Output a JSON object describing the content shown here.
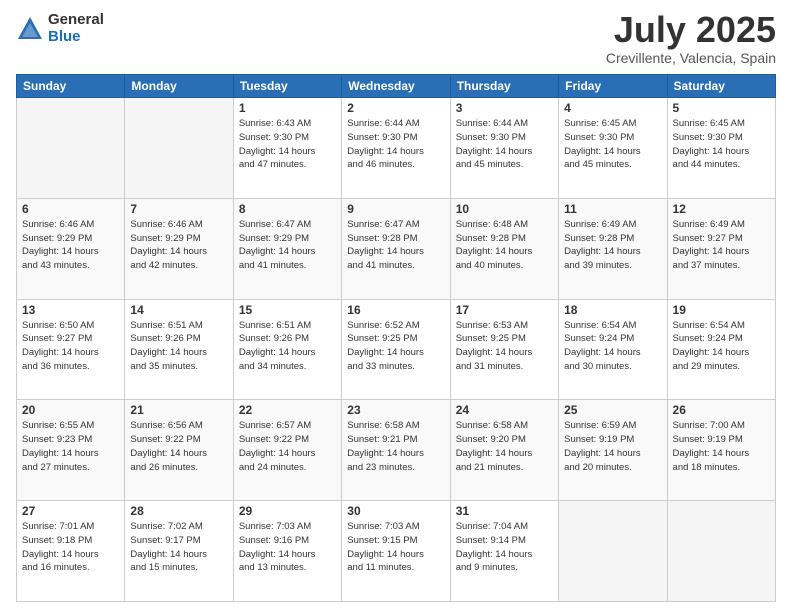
{
  "logo": {
    "general": "General",
    "blue": "Blue"
  },
  "title": {
    "month": "July 2025",
    "location": "Crevillente, Valencia, Spain"
  },
  "weekdays": [
    "Sunday",
    "Monday",
    "Tuesday",
    "Wednesday",
    "Thursday",
    "Friday",
    "Saturday"
  ],
  "weeks": [
    [
      {
        "day": "",
        "info": ""
      },
      {
        "day": "",
        "info": ""
      },
      {
        "day": "1",
        "info": "Sunrise: 6:43 AM\nSunset: 9:30 PM\nDaylight: 14 hours\nand 47 minutes."
      },
      {
        "day": "2",
        "info": "Sunrise: 6:44 AM\nSunset: 9:30 PM\nDaylight: 14 hours\nand 46 minutes."
      },
      {
        "day": "3",
        "info": "Sunrise: 6:44 AM\nSunset: 9:30 PM\nDaylight: 14 hours\nand 45 minutes."
      },
      {
        "day": "4",
        "info": "Sunrise: 6:45 AM\nSunset: 9:30 PM\nDaylight: 14 hours\nand 45 minutes."
      },
      {
        "day": "5",
        "info": "Sunrise: 6:45 AM\nSunset: 9:30 PM\nDaylight: 14 hours\nand 44 minutes."
      }
    ],
    [
      {
        "day": "6",
        "info": "Sunrise: 6:46 AM\nSunset: 9:29 PM\nDaylight: 14 hours\nand 43 minutes."
      },
      {
        "day": "7",
        "info": "Sunrise: 6:46 AM\nSunset: 9:29 PM\nDaylight: 14 hours\nand 42 minutes."
      },
      {
        "day": "8",
        "info": "Sunrise: 6:47 AM\nSunset: 9:29 PM\nDaylight: 14 hours\nand 41 minutes."
      },
      {
        "day": "9",
        "info": "Sunrise: 6:47 AM\nSunset: 9:28 PM\nDaylight: 14 hours\nand 41 minutes."
      },
      {
        "day": "10",
        "info": "Sunrise: 6:48 AM\nSunset: 9:28 PM\nDaylight: 14 hours\nand 40 minutes."
      },
      {
        "day": "11",
        "info": "Sunrise: 6:49 AM\nSunset: 9:28 PM\nDaylight: 14 hours\nand 39 minutes."
      },
      {
        "day": "12",
        "info": "Sunrise: 6:49 AM\nSunset: 9:27 PM\nDaylight: 14 hours\nand 37 minutes."
      }
    ],
    [
      {
        "day": "13",
        "info": "Sunrise: 6:50 AM\nSunset: 9:27 PM\nDaylight: 14 hours\nand 36 minutes."
      },
      {
        "day": "14",
        "info": "Sunrise: 6:51 AM\nSunset: 9:26 PM\nDaylight: 14 hours\nand 35 minutes."
      },
      {
        "day": "15",
        "info": "Sunrise: 6:51 AM\nSunset: 9:26 PM\nDaylight: 14 hours\nand 34 minutes."
      },
      {
        "day": "16",
        "info": "Sunrise: 6:52 AM\nSunset: 9:25 PM\nDaylight: 14 hours\nand 33 minutes."
      },
      {
        "day": "17",
        "info": "Sunrise: 6:53 AM\nSunset: 9:25 PM\nDaylight: 14 hours\nand 31 minutes."
      },
      {
        "day": "18",
        "info": "Sunrise: 6:54 AM\nSunset: 9:24 PM\nDaylight: 14 hours\nand 30 minutes."
      },
      {
        "day": "19",
        "info": "Sunrise: 6:54 AM\nSunset: 9:24 PM\nDaylight: 14 hours\nand 29 minutes."
      }
    ],
    [
      {
        "day": "20",
        "info": "Sunrise: 6:55 AM\nSunset: 9:23 PM\nDaylight: 14 hours\nand 27 minutes."
      },
      {
        "day": "21",
        "info": "Sunrise: 6:56 AM\nSunset: 9:22 PM\nDaylight: 14 hours\nand 26 minutes."
      },
      {
        "day": "22",
        "info": "Sunrise: 6:57 AM\nSunset: 9:22 PM\nDaylight: 14 hours\nand 24 minutes."
      },
      {
        "day": "23",
        "info": "Sunrise: 6:58 AM\nSunset: 9:21 PM\nDaylight: 14 hours\nand 23 minutes."
      },
      {
        "day": "24",
        "info": "Sunrise: 6:58 AM\nSunset: 9:20 PM\nDaylight: 14 hours\nand 21 minutes."
      },
      {
        "day": "25",
        "info": "Sunrise: 6:59 AM\nSunset: 9:19 PM\nDaylight: 14 hours\nand 20 minutes."
      },
      {
        "day": "26",
        "info": "Sunrise: 7:00 AM\nSunset: 9:19 PM\nDaylight: 14 hours\nand 18 minutes."
      }
    ],
    [
      {
        "day": "27",
        "info": "Sunrise: 7:01 AM\nSunset: 9:18 PM\nDaylight: 14 hours\nand 16 minutes."
      },
      {
        "day": "28",
        "info": "Sunrise: 7:02 AM\nSunset: 9:17 PM\nDaylight: 14 hours\nand 15 minutes."
      },
      {
        "day": "29",
        "info": "Sunrise: 7:03 AM\nSunset: 9:16 PM\nDaylight: 14 hours\nand 13 minutes."
      },
      {
        "day": "30",
        "info": "Sunrise: 7:03 AM\nSunset: 9:15 PM\nDaylight: 14 hours\nand 11 minutes."
      },
      {
        "day": "31",
        "info": "Sunrise: 7:04 AM\nSunset: 9:14 PM\nDaylight: 14 hours\nand 9 minutes."
      },
      {
        "day": "",
        "info": ""
      },
      {
        "day": "",
        "info": ""
      }
    ]
  ]
}
